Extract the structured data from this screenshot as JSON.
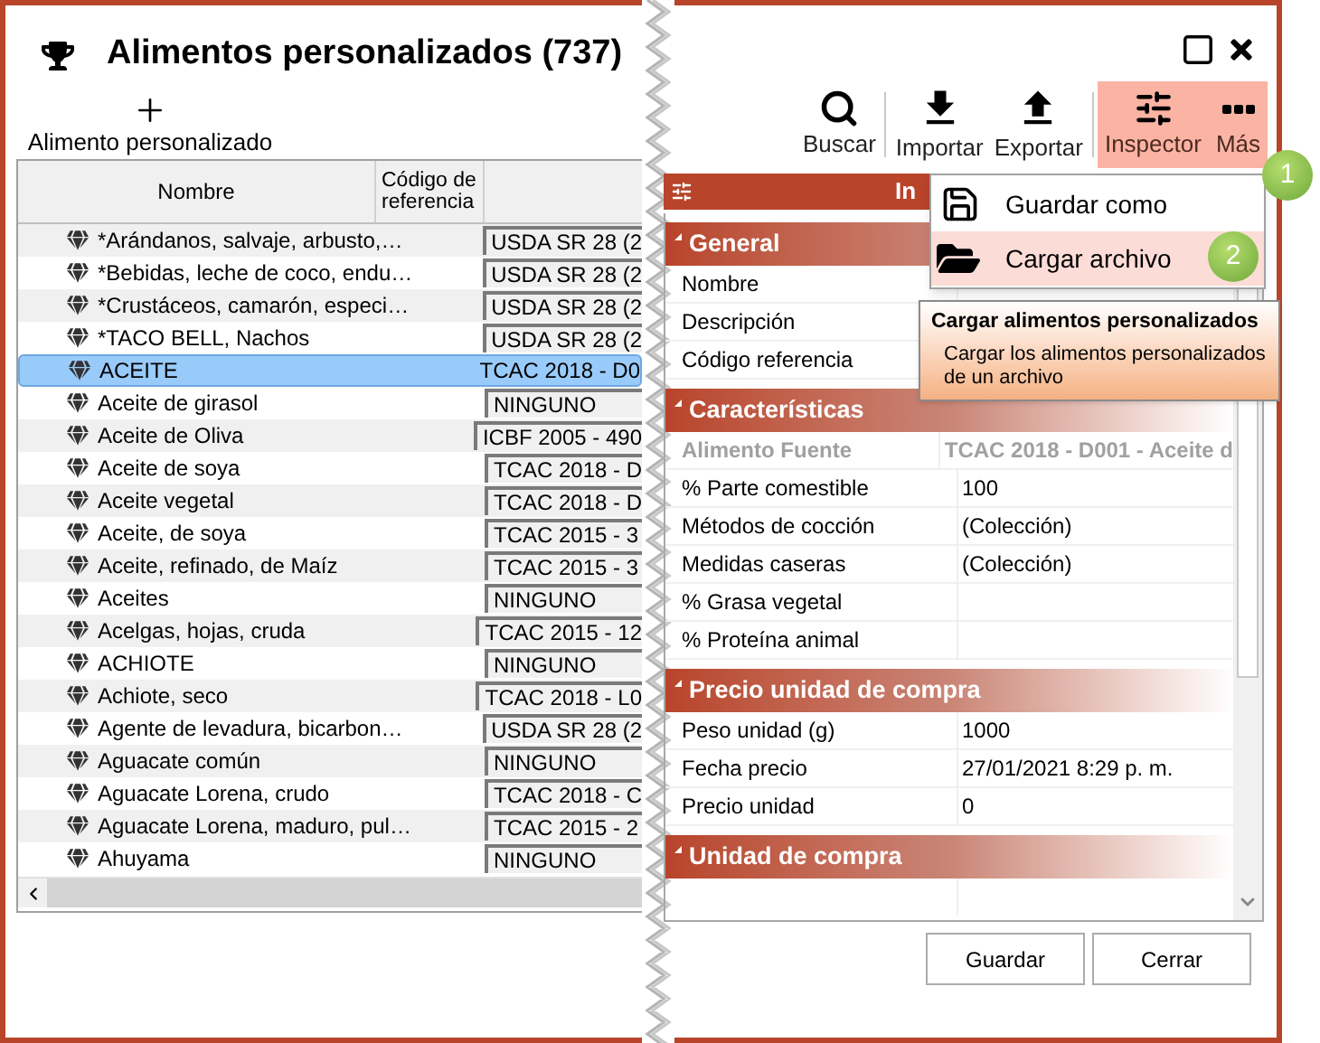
{
  "window": {
    "title": "Alimentos personalizados (737)"
  },
  "new_item": {
    "label": "Alimento personalizado"
  },
  "table": {
    "columns": [
      {
        "label": "Nombre"
      },
      {
        "label": "Código de referencia"
      }
    ],
    "rows": [
      {
        "name": "*Arándanos, salvaje, arbusto,…",
        "source": "USDA SR 28 (2",
        "selected": false
      },
      {
        "name": "*Bebidas, leche de coco, endu…",
        "source": "USDA SR 28 (2",
        "selected": false
      },
      {
        "name": "*Crustáceos, camarón, especi…",
        "source": "USDA SR 28 (2",
        "selected": false
      },
      {
        "name": "*TACO BELL, Nachos",
        "source": "USDA SR 28 (2",
        "selected": false
      },
      {
        "name": "ACEITE",
        "source": "TCAC 2018 - D0",
        "selected": true
      },
      {
        "name": "Aceite de girasol",
        "source": "NINGUNO",
        "selected": false
      },
      {
        "name": "Aceite de Oliva",
        "source": "ICBF 2005 - 490",
        "selected": false
      },
      {
        "name": "Aceite de soya",
        "source": "TCAC 2018 - D",
        "selected": false
      },
      {
        "name": "Aceite vegetal",
        "source": "TCAC 2018 - D",
        "selected": false
      },
      {
        "name": "Aceite, de soya",
        "source": "TCAC 2015 - 3",
        "selected": false
      },
      {
        "name": "Aceite, refinado, de Maíz",
        "source": "TCAC 2015 - 3",
        "selected": false
      },
      {
        "name": "Aceites",
        "source": "NINGUNO",
        "selected": false
      },
      {
        "name": "Acelgas, hojas, cruda",
        "source": "TCAC 2015 - 12",
        "selected": false
      },
      {
        "name": "ACHIOTE",
        "source": "NINGUNO",
        "selected": false
      },
      {
        "name": "Achiote, seco",
        "source": "TCAC 2018 - L0",
        "selected": false
      },
      {
        "name": "Agente de levadura, bicarbon…",
        "source": "USDA SR 28 (2",
        "selected": false
      },
      {
        "name": "Aguacate común",
        "source": "NINGUNO",
        "selected": false
      },
      {
        "name": "Aguacate Lorena, crudo",
        "source": "TCAC 2018 - C",
        "selected": false
      },
      {
        "name": "Aguacate Lorena, maduro, pul…",
        "source": "TCAC 2015 - 2",
        "selected": false
      },
      {
        "name": "Ahuyama",
        "source": "NINGUNO",
        "selected": false
      }
    ]
  },
  "toolbar": [
    {
      "label": "Buscar",
      "kind": "search",
      "active": false
    },
    {
      "label": "Importar",
      "kind": "import",
      "active": false
    },
    {
      "label": "Exportar",
      "kind": "export",
      "active": false
    },
    {
      "label": "Inspector",
      "kind": "inspector",
      "active": true
    },
    {
      "label": "Más",
      "kind": "more",
      "active": true
    }
  ],
  "inspector": {
    "title": "In",
    "sections": [
      {
        "title": "General",
        "rows": [
          {
            "label": "Nombre",
            "disabled": false
          },
          {
            "label": "Descripción",
            "disabled": false
          },
          {
            "label": "Código referencia",
            "disabled": false
          }
        ]
      },
      {
        "title": "Características",
        "rows": [
          {
            "label": "Alimento Fuente",
            "value": "TCAC 2018 - D001 - Aceite d",
            "disabled": true
          },
          {
            "label": "% Parte comestible",
            "value": "100",
            "disabled": false
          },
          {
            "label": "Métodos de cocción",
            "value": "(Colección)",
            "disabled": false
          },
          {
            "label": "Medidas caseras",
            "value": "(Colección)",
            "disabled": false
          },
          {
            "label": "% Grasa vegetal",
            "disabled": false
          },
          {
            "label": "% Proteína animal",
            "disabled": false
          }
        ]
      },
      {
        "title": "Precio unidad de compra",
        "rows": [
          {
            "label": "Peso unidad (g)",
            "value": "1000",
            "disabled": false
          },
          {
            "label": "Fecha precio",
            "value": "27/01/2021 8:29 p. m.",
            "disabled": false
          },
          {
            "label": "Precio unidad",
            "value": "0",
            "disabled": false
          }
        ]
      },
      {
        "title": "Unidad de compra"
      }
    ]
  },
  "menu": {
    "items": [
      {
        "label": "Guardar como",
        "kind": "save",
        "selected": false
      },
      {
        "label": "Cargar archivo",
        "kind": "load",
        "selected": true
      }
    ]
  },
  "tooltip": {
    "title": "Cargar alimentos personalizados",
    "text": "Cargar los alimentos personalizados de un archivo"
  },
  "callouts": [
    "1",
    "2"
  ],
  "buttons": [
    "Guardar",
    "Cerrar"
  ]
}
